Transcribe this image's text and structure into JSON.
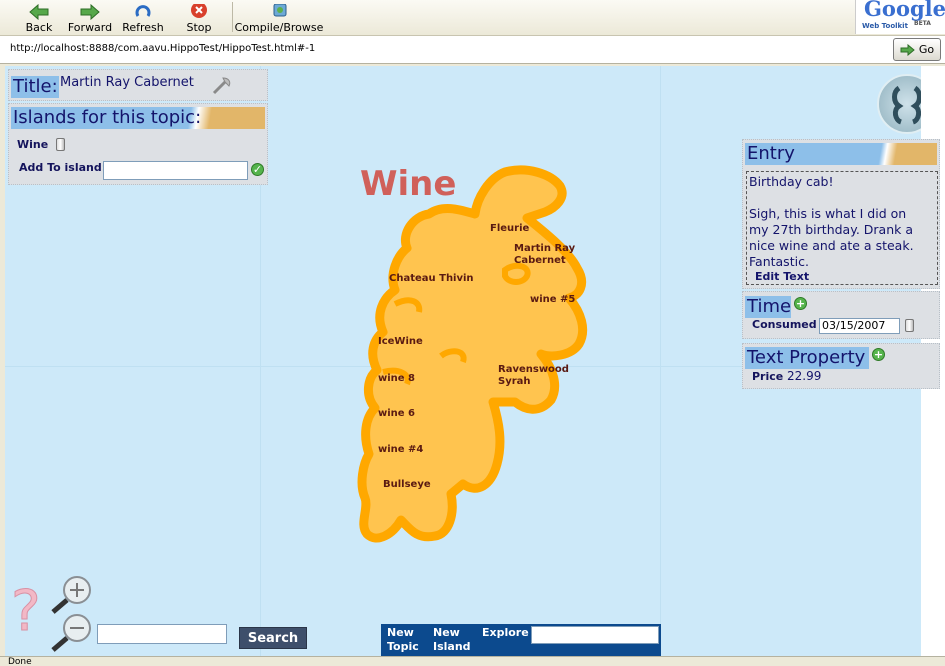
{
  "toolbar": {
    "back": "Back",
    "forward": "Forward",
    "refresh": "Refresh",
    "stop": "Stop",
    "compile": "Compile/Browse",
    "logo_text": "Google",
    "logo_sub": "Web Toolkit",
    "logo_beta": "BETA"
  },
  "address": {
    "url": "http://localhost:8888/com.aavu.HippoTest/HippoTest.html#-1",
    "go_label": "Go"
  },
  "title_panel": {
    "label": "Title:",
    "value": "Martin Ray Cabernet"
  },
  "islands_panel": {
    "header": "Islands for this topic:",
    "item": "Wine",
    "add_label": "Add To island:",
    "add_value": ""
  },
  "map": {
    "island_title": "Wine",
    "labels": [
      "Fleurie",
      "Martin Ray",
      "Cabernet",
      "Chateau Thivin",
      "wine #5",
      "IceWine",
      "Ravenswood",
      "Syrah",
      "wine 8",
      "wine 6",
      "wine #4",
      "Bullseye"
    ]
  },
  "entry_panel": {
    "header": "Entry",
    "line1": "Birthday cab!",
    "line2": "Sigh, this is what I did on",
    "line3": "my 27th birthday. Drank a",
    "line4": "nice wine and ate a steak.",
    "line5": "Fantastic.",
    "edit_link": "Edit Text"
  },
  "time_panel": {
    "header": "Time",
    "label": "Consumed",
    "value": "03/15/2007"
  },
  "property_panel": {
    "header": "Text Property",
    "label": "Price",
    "value": "22.99"
  },
  "bottom": {
    "search_value": "",
    "search_button": "Search",
    "nav_new_topic_1": "New",
    "nav_new_topic_2": "Topic",
    "nav_new_island_1": "New",
    "nav_new_island_2": "Island",
    "nav_explore": "Explore",
    "explore_value": ""
  },
  "status": {
    "text": "Done"
  },
  "colors": {
    "map_bg": "#cde9f9",
    "island_fill": "#ffc44f",
    "island_border": "#ffa800",
    "title_color": "#d0605a",
    "header_blue": "#8dbfe9",
    "header_text": "#14146b"
  }
}
